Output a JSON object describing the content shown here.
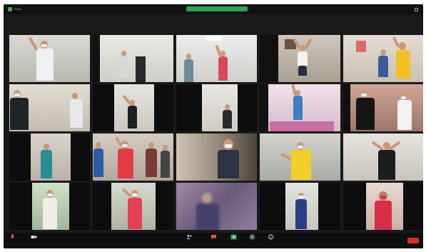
{
  "app": {
    "window_title_indicator": "Zoom"
  },
  "gallery": {
    "tiles": [
      {
        "name": ""
      },
      {
        "name": ""
      },
      {
        "name": ""
      },
      {
        "name": ""
      },
      {
        "name": ""
      },
      {
        "name": ""
      },
      {
        "name": ""
      },
      {
        "name": ""
      },
      {
        "name": ""
      },
      {
        "name": ""
      },
      {
        "name": ""
      },
      {
        "name": ""
      },
      {
        "name": ""
      },
      {
        "name": ""
      },
      {
        "name": ""
      },
      {
        "name": ""
      },
      {
        "name": ""
      },
      {
        "name": ""
      },
      {
        "name": ""
      },
      {
        "name": ""
      }
    ]
  },
  "toolbar": {
    "buttons": [
      {
        "name": "unmute-button",
        "icon": "microphone-icon",
        "label": ""
      },
      {
        "name": "video-button",
        "icon": "video-camera-icon",
        "label": ""
      },
      {
        "name": "participants-button",
        "icon": "participants-icon",
        "label": "",
        "count": "20"
      },
      {
        "name": "chat-button",
        "icon": "chat-icon",
        "label": ""
      },
      {
        "name": "share-screen-button",
        "icon": "share-screen-icon",
        "label": ""
      },
      {
        "name": "record-button",
        "icon": "record-icon",
        "label": ""
      },
      {
        "name": "reactions-button",
        "icon": "reactions-icon",
        "label": ""
      }
    ],
    "end_label": ""
  },
  "colors": {
    "window_bg": "#1a1a1a",
    "accent_green": "#2ea44f",
    "end_red": "#d93025"
  }
}
